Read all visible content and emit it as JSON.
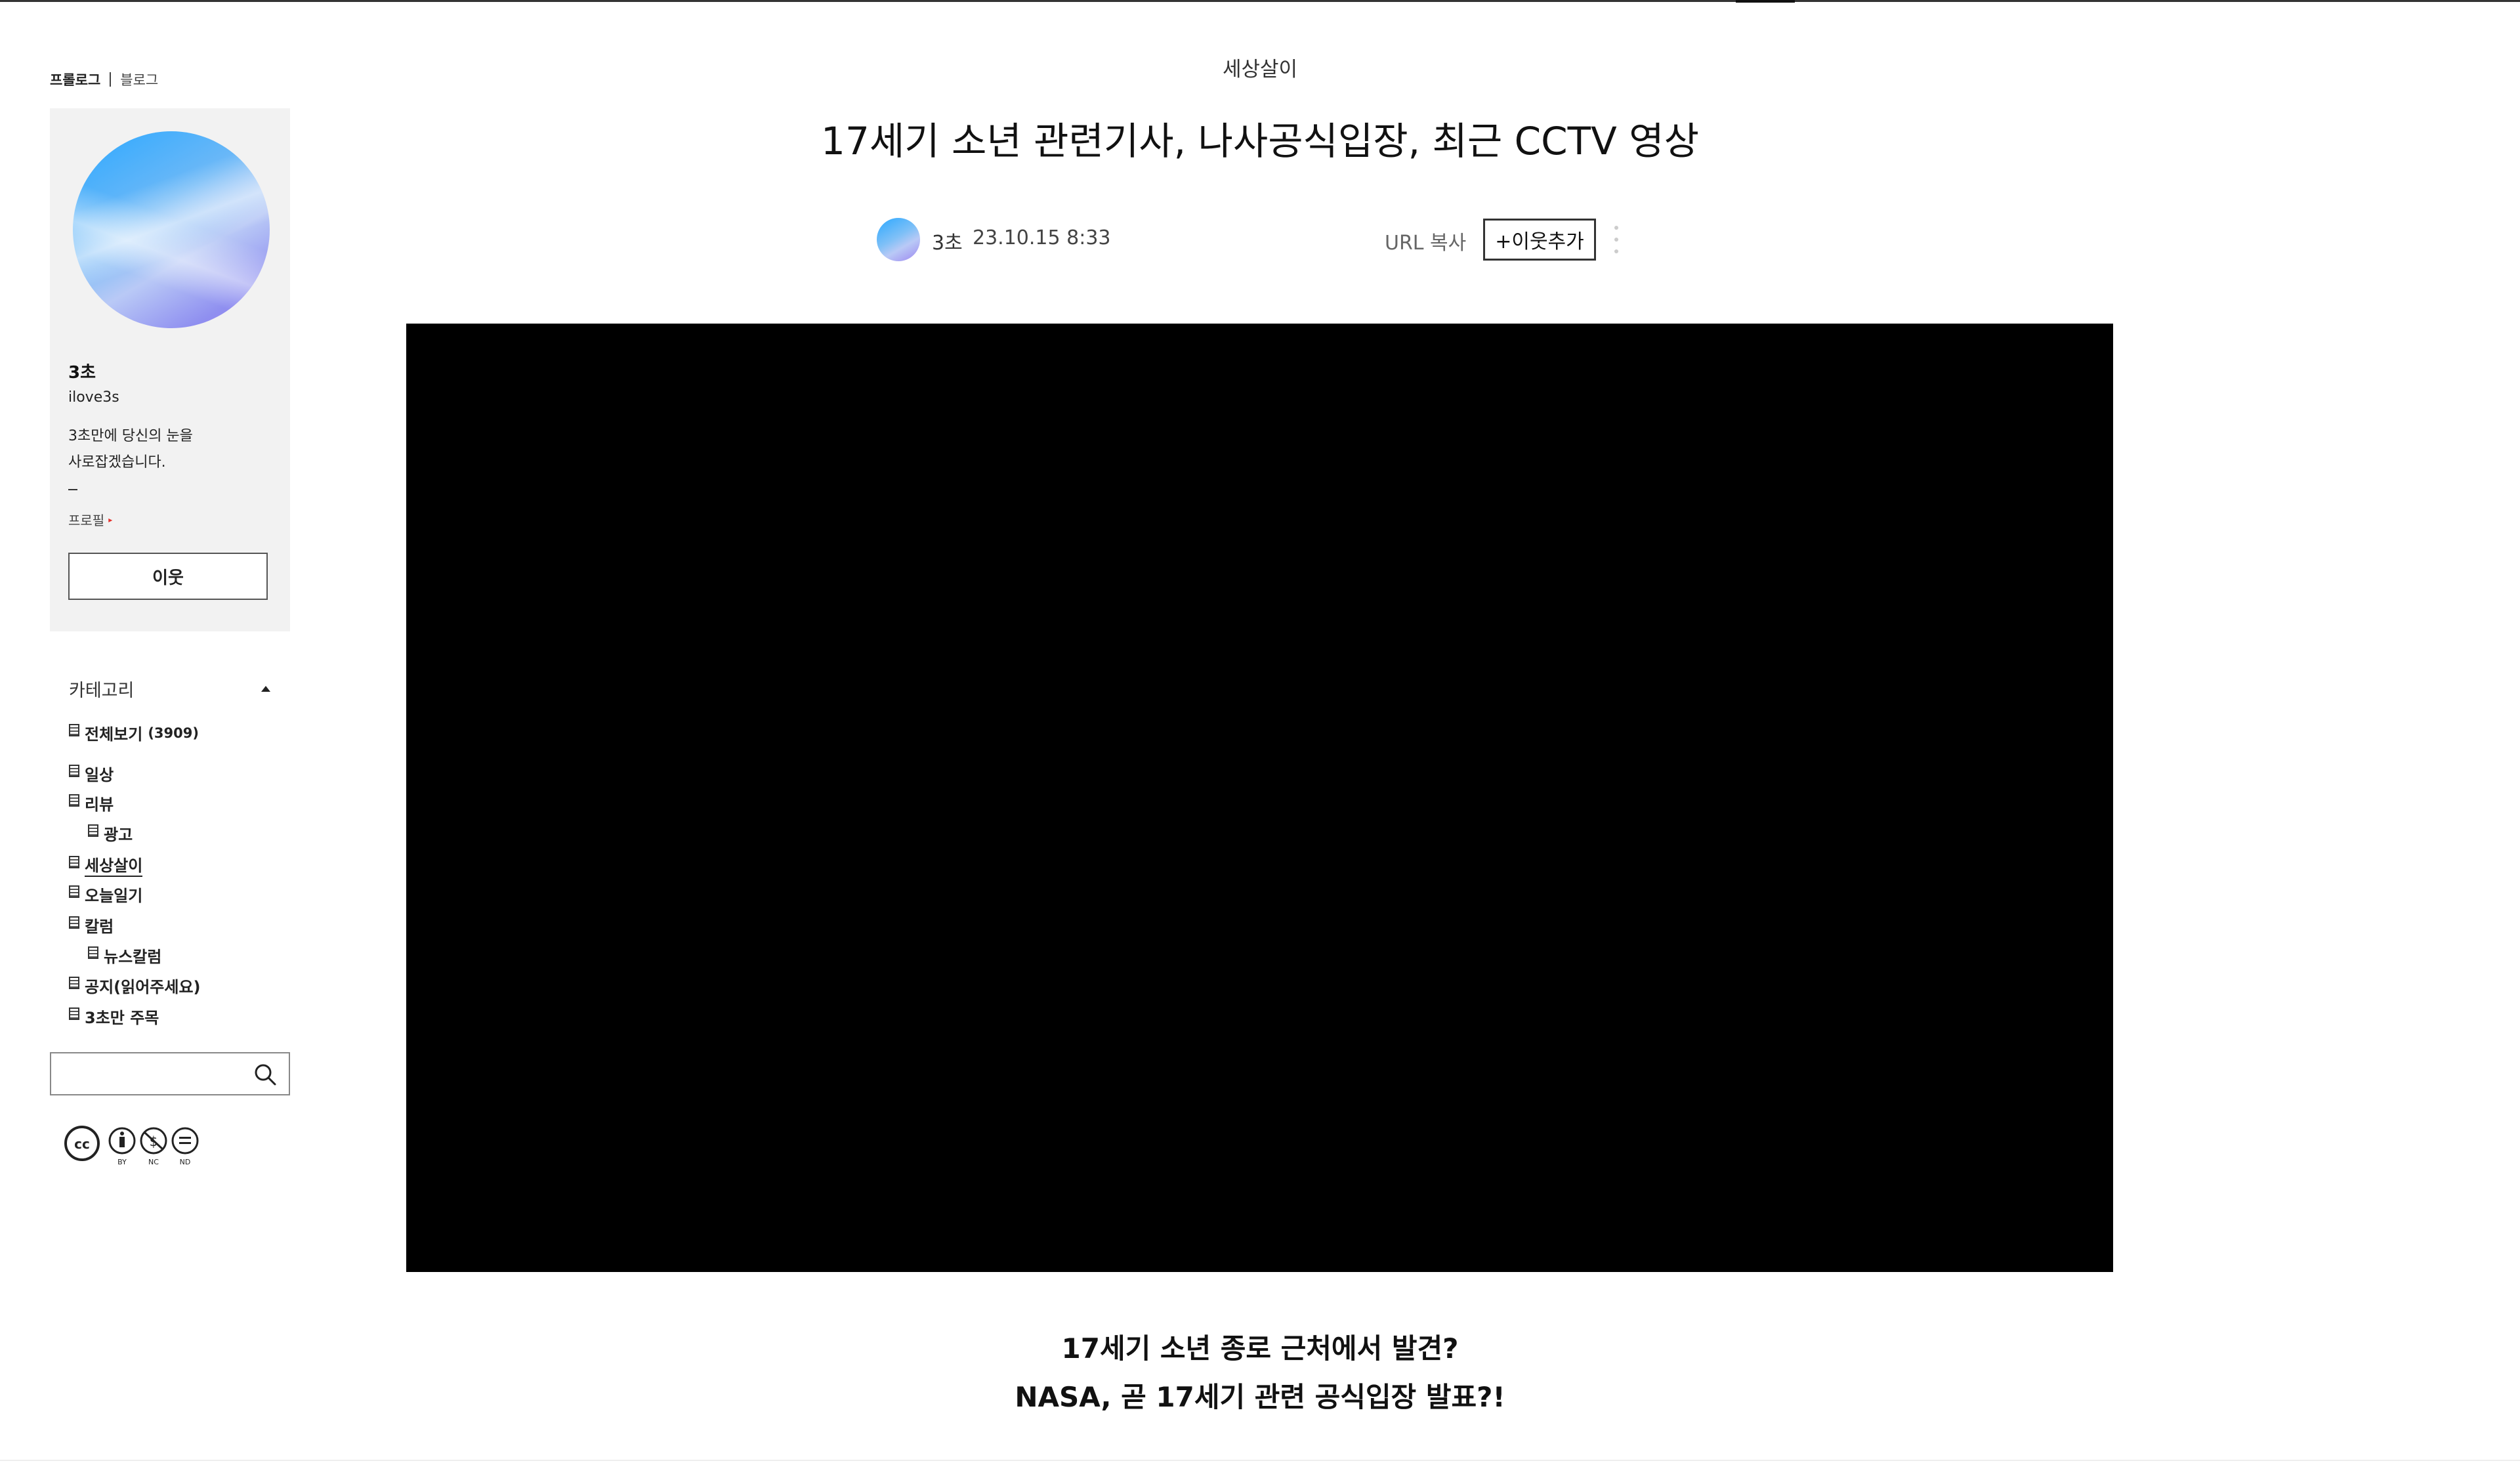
{
  "sidebar": {
    "tabs": {
      "active": "프롤로그",
      "other": "블로그"
    },
    "profile": {
      "name": "3초",
      "id": "ilove3s",
      "description_line1": "3초만에 당신의 눈을",
      "description_line2": "사로잡겠습니다.",
      "profile_link": "프로필",
      "neighbor_button": "이웃"
    },
    "category": {
      "header": "카테고리",
      "all": {
        "label": "전체보기",
        "count": "(3909)"
      },
      "items": [
        {
          "label": "일상"
        },
        {
          "label": "리뷰"
        },
        {
          "label": "광고"
        },
        {
          "label": "세상살이"
        },
        {
          "label": "오늘일기"
        },
        {
          "label": "칼럼"
        },
        {
          "label": "뉴스칼럼"
        },
        {
          "label": "공지(읽어주세요)"
        },
        {
          "label": "3초만 주목"
        }
      ]
    },
    "search": {
      "placeholder": ""
    },
    "license": {
      "icon": "creative-commons-by-nc-nd-icon"
    }
  },
  "post": {
    "category": "세상살이",
    "title": "17세기 소년 관련기사, 나사공식입장, 최근 CCTV 영상",
    "author": "3초",
    "date": "23.10.15 8:33",
    "url_copy": "URL 복사",
    "add_neighbor": "+이웃추가",
    "body_line1": "17세기 소년 종로 근처에서 발견?",
    "body_line2": "NASA,  곧 17세기 관련 공식입장 발표?!"
  },
  "colors": {
    "accent_red": "#e5322d",
    "card_bg": "#f2f2f2",
    "video_bg": "#000000"
  }
}
